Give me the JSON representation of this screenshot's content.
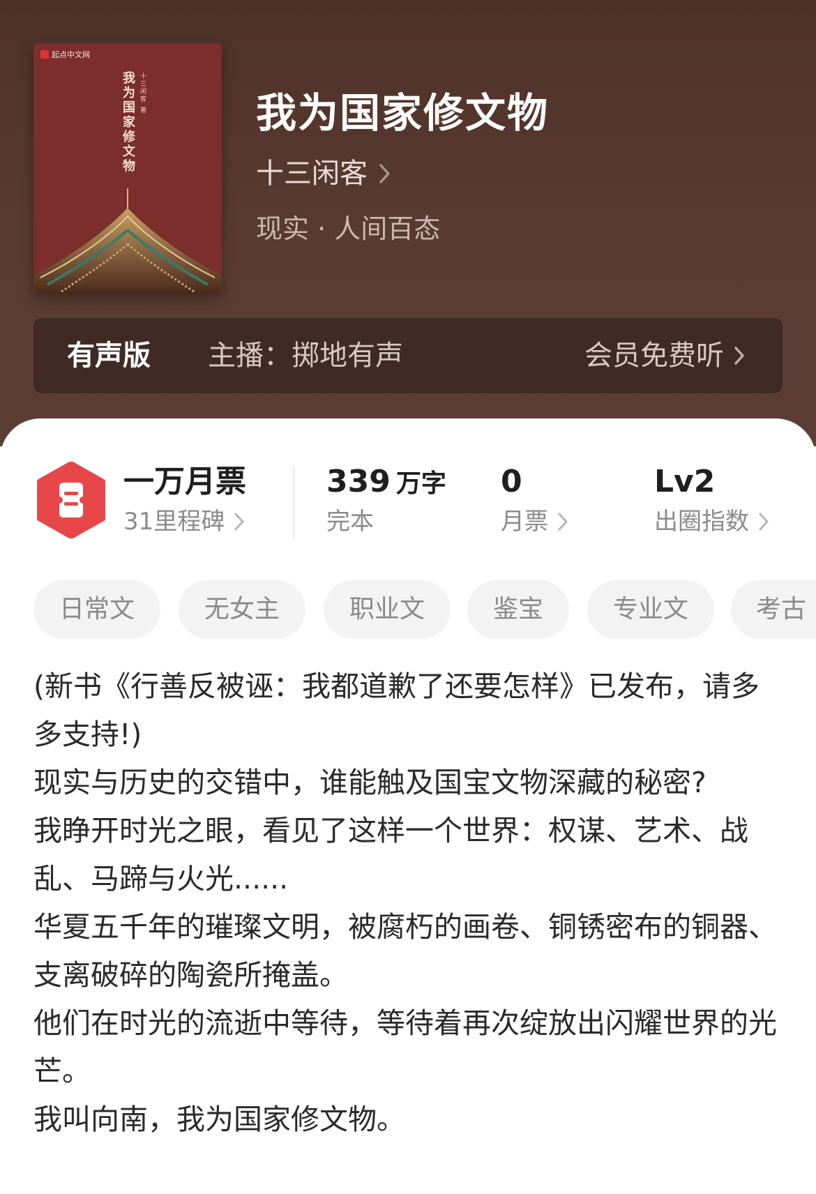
{
  "book": {
    "title": "我为国家修文物",
    "author": "十三闲客",
    "genre": "现实 · 人间百态",
    "cover": {
      "publisher": "起点中文网",
      "title": "我为国家修文物",
      "author_line": "十三闲客 著"
    }
  },
  "audio": {
    "label": "有声版",
    "anchor": "主播：掷地有声",
    "listen": "会员免费听"
  },
  "stats": {
    "honor": {
      "title": "一万月票",
      "sub": "31里程碑"
    },
    "words": {
      "value": "339",
      "unit": "万字",
      "sub": "完本"
    },
    "tickets": {
      "value": "0",
      "sub": "月票"
    },
    "index": {
      "value": "Lv2",
      "sub": "出圈指数"
    }
  },
  "tags": [
    "日常文",
    "无女主",
    "职业文",
    "鉴宝",
    "专业文",
    "考古"
  ],
  "description": [
    "(新书《行善反被诬：我都道歉了还要怎样》已发布，请多多支持!)",
    "现实与历史的交错中，谁能触及国宝文物深藏的秘密?",
    "我睁开时光之眼，看见了这样一个世界：权谋、艺术、战乱、马蹄与火光......",
    "华夏五千年的璀璨文明，被腐朽的画卷、铜锈密布的铜器、支离破碎的陶瓷所掩盖。",
    "他们在时光的流逝中等待，等待着再次绽放出闪耀世界的光芒。",
    "我叫向南，我为国家修文物。"
  ],
  "colors": {
    "header_bg": "#54362d",
    "audio_bar_bg": "#3f2a24",
    "badge_red": "#e8474a",
    "cover_red": "#7b2e2b"
  },
  "icons": {
    "chevron": "chevron-right-icon",
    "badge": "ticket-badge-icon"
  }
}
